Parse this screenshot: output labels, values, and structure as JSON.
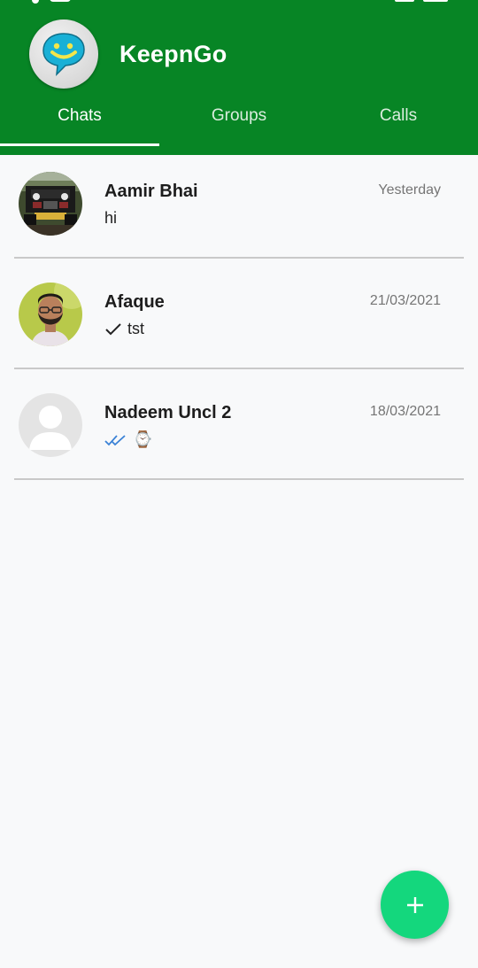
{
  "header": {
    "app_title": "KeepnGo",
    "logo_icon": "smiley-speech-bubble-icon",
    "background_color": "#078525"
  },
  "tabs": [
    {
      "label": "Chats",
      "active": true
    },
    {
      "label": "Groups",
      "active": false
    },
    {
      "label": "Calls",
      "active": false
    }
  ],
  "chats": [
    {
      "name": "Aamir Bhai",
      "preview": "hi",
      "time": "Yesterday",
      "status_icon": null,
      "avatar": "photo-jeep-avatar"
    },
    {
      "name": "Afaque",
      "preview": "tst",
      "time": "21/03/2021",
      "status_icon": "single-check-icon",
      "avatar": "photo-man-avatar"
    },
    {
      "name": "Nadeem Uncl 2",
      "preview": "⌚",
      "time": "18/03/2021",
      "status_icon": "double-check-blue-icon",
      "avatar": "default-person-avatar"
    }
  ],
  "fab": {
    "icon": "plus-icon",
    "color": "#14d77d"
  }
}
